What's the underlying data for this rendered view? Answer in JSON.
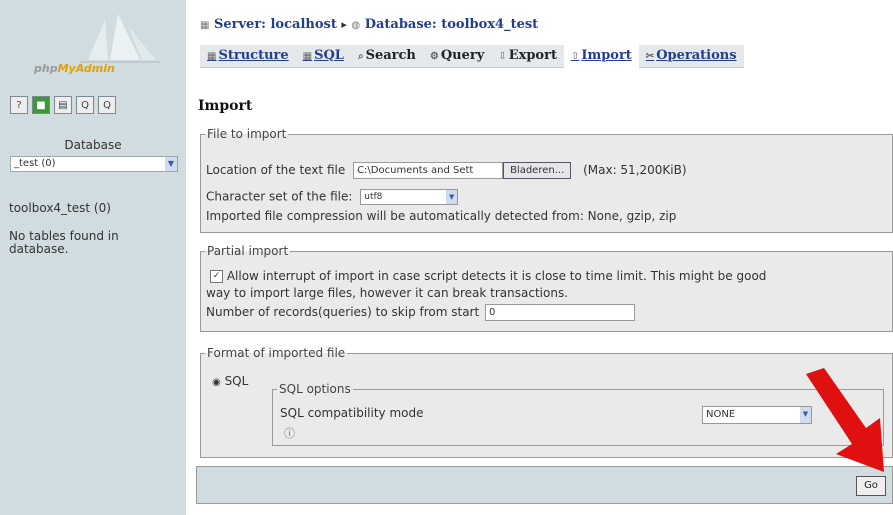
{
  "left": {
    "logo_text_part1": "php",
    "logo_text_part2": "MyAdmin",
    "icons": [
      "?",
      "■",
      "▤",
      "Q",
      "Q"
    ],
    "database_label": "Database",
    "database_select_value": "_test (0)",
    "database_link": "toolbox4_test (0)",
    "no_tables": "No tables found in database."
  },
  "breadcrumb": {
    "server": "Server: localhost",
    "separator": "▸",
    "database": "Database: toolbox4_test"
  },
  "tabs": [
    {
      "label": "Structure",
      "icon": "▦"
    },
    {
      "label": "SQL",
      "icon": "▦"
    },
    {
      "label": "Search",
      "icon": "⌕"
    },
    {
      "label": "Query",
      "icon": "⚙"
    },
    {
      "label": "Export",
      "icon": "⇩"
    },
    {
      "label": "Import",
      "icon": "⇧"
    },
    {
      "label": "Operations",
      "icon": "✂"
    }
  ],
  "page_title": "Import",
  "file_to_import": {
    "legend": "File to import",
    "location_label": "Location of the text file",
    "location_value": "C:\\Documents and Sett",
    "browse_label": "Bladeren...",
    "max_text": "(Max: 51,200KiB)",
    "charset_label": "Character set of the file:",
    "charset_value": "utf8",
    "compression_text": "Imported file compression will be automatically detected from: None, gzip, zip"
  },
  "partial_import": {
    "legend": "Partial import",
    "allow_text_line1": "Allow interrupt of import in case script detects it is close to time limit. This might be good",
    "allow_text_line2": "way to import large files, however it can break transactions.",
    "skip_label": "Number of records(queries) to skip from start",
    "skip_value": "0"
  },
  "format": {
    "legend": "Format of imported file",
    "sql_radio_label": "SQL",
    "sql_options_legend": "SQL options",
    "compat_label": "SQL compatibility mode",
    "compat_value": "NONE",
    "info_icon": "ⓘ"
  },
  "go_label": "Go",
  "arrow_color": "#e01010"
}
